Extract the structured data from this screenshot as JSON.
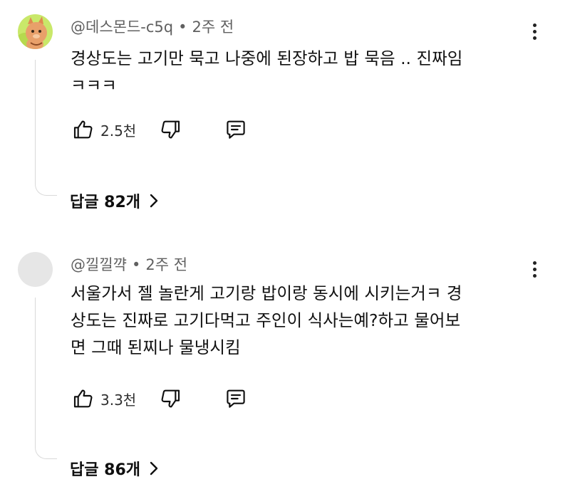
{
  "comments": [
    {
      "author": "@데스몬드-c5q",
      "time": "2주 전",
      "text_lines": [
        "경상도는 고기만 묵고 나중에 된장하고 밥 묵음 .. 진짜임",
        "ㅋㅋㅋ"
      ],
      "likes": "2.5천",
      "replies_label": "답글 82개"
    },
    {
      "author": "@낄낄꺅",
      "time": "2주 전",
      "text_lines": [
        "서울가서 젤 놀란게 고기랑 밥이랑 동시에 시키는거ㅋ 경",
        "상도는 진짜로 고기다먹고 주인이  식사는예?하고 물어보",
        "면 그때 된찌나 물냉시킴"
      ],
      "likes": "3.3천",
      "replies_label": "답글 86개"
    }
  ],
  "icons": {
    "like": "thumbs-up-icon",
    "dislike": "thumbs-down-icon",
    "reply": "reply-comment-icon",
    "more": "more-vertical-icon",
    "expand": "chevron-right-icon"
  },
  "colors": {
    "meta_text": "#606060",
    "thread_line": "#d9d9d9",
    "avatar_placeholder": "#e6e6e6"
  }
}
